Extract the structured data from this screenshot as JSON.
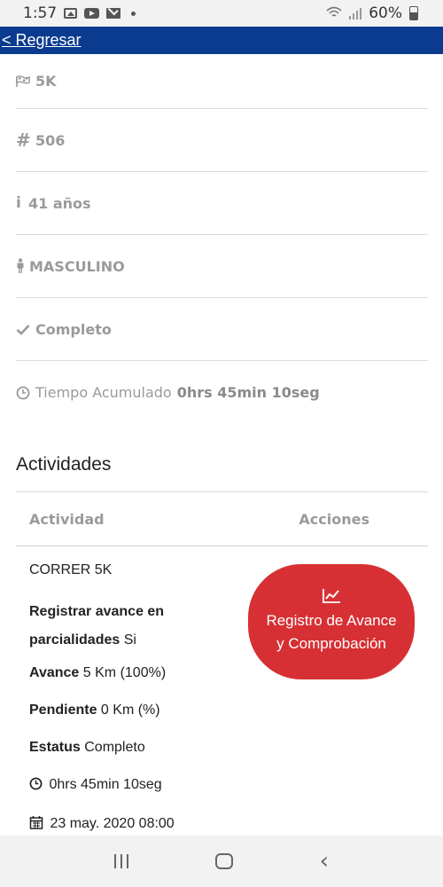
{
  "status_bar": {
    "time": "1:57",
    "battery": "60%"
  },
  "nav": {
    "back_label": "< Regresar"
  },
  "info": {
    "distance": "5K",
    "bib": "506",
    "age": "41 años",
    "gender": "MASCULINO",
    "status": "Completo",
    "time_label": "Tiempo Acumulado",
    "time_value": "0hrs 45min 10seg"
  },
  "activities": {
    "title": "Actividades",
    "headers": {
      "activity": "Actividad",
      "actions": "Acciones"
    },
    "row": {
      "name": "CORRER 5K",
      "register_label": "Registrar avance en parcialidades",
      "register_value": "Si",
      "advance_label": "Avance",
      "advance_value": "5 Km (100%)",
      "pending_label": "Pendiente",
      "pending_value": "0 Km (%)",
      "status_label": "Estatus",
      "status_value": "Completo",
      "duration": "0hrs 45min 10seg",
      "date": "23 may. 2020 08:00",
      "button_label": "Registro de Avance y Comprobación"
    }
  },
  "colors": {
    "nav_bar": "#0b3b8f",
    "action_button": "#d63034",
    "muted_text": "#9a9a9a"
  },
  "icons": [
    "flag-icon",
    "hash-icon",
    "info-icon",
    "male-icon",
    "check-icon",
    "clock-icon",
    "chart-icon",
    "calendar-icon"
  ]
}
